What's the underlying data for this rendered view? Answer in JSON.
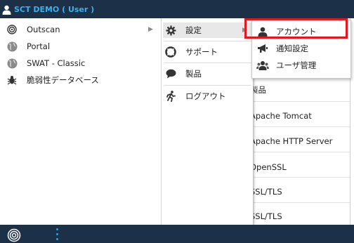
{
  "topbar": {
    "user_label": "SCT DEMO ( User )",
    "user_icon": "user-icon"
  },
  "menu": {
    "left_items": [
      {
        "label": "Outscan",
        "icon": "target-icon",
        "has_submenu": true
      },
      {
        "label": "Portal",
        "icon": "globe-icon"
      },
      {
        "label": "SWAT - Classic",
        "icon": "globe-icon"
      },
      {
        "label": "脆弱性データベース",
        "icon": "bug-icon"
      }
    ],
    "right_items": [
      {
        "label": "設定",
        "icon": "gear-icon",
        "has_submenu": true
      },
      {
        "label": "サポート",
        "icon": "lifebuoy-icon"
      },
      {
        "label": "製品",
        "icon": "chat-icon"
      },
      {
        "label": "ログアウト",
        "icon": "running-man-icon"
      }
    ]
  },
  "submenu": {
    "items": [
      {
        "label": "アカウント",
        "icon": "user-icon"
      },
      {
        "label": "通知設定",
        "icon": "megaphone-icon"
      },
      {
        "label": "ユーザ管理",
        "icon": "users-icon"
      }
    ]
  },
  "background": {
    "items": [
      "製品",
      "Apache Tomcat",
      "Apache HTTP Server",
      "OpenSSL",
      "SSL/TLS",
      "SSL/TLS"
    ]
  },
  "colors": {
    "navbar": "#1c3047",
    "accent": "#39b0f0",
    "highlight": "#e4161e"
  }
}
